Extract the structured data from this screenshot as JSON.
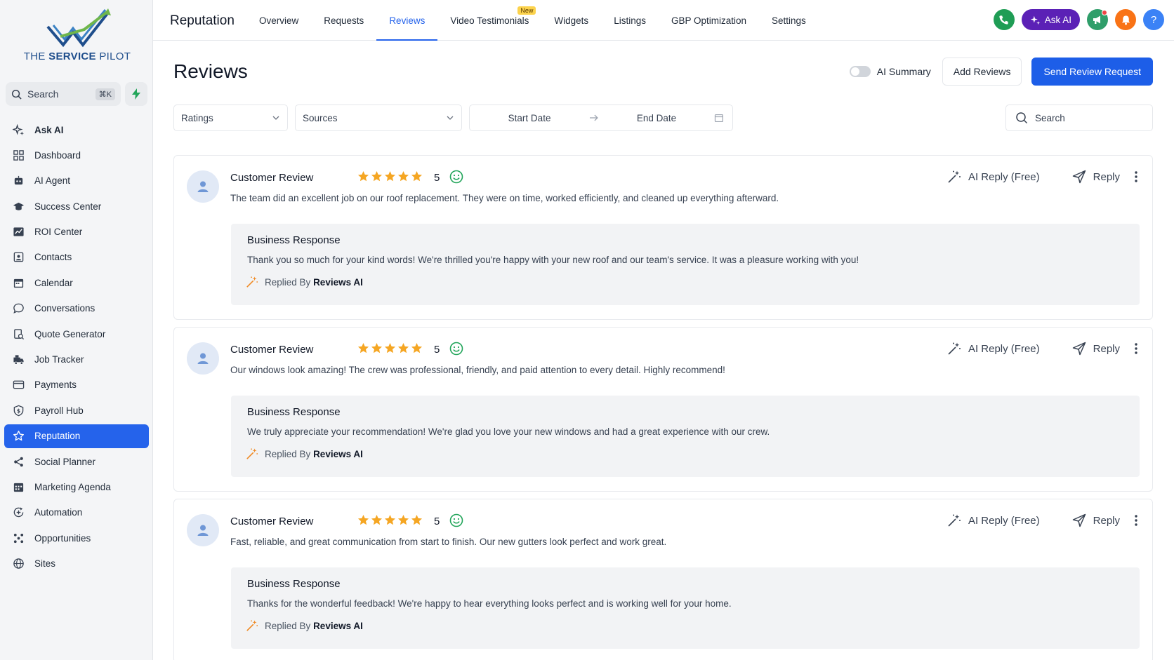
{
  "brand": {
    "name_part1": "THE",
    "name_part2": "SERVICE",
    "name_part3": "PILOT"
  },
  "sidebar": {
    "search_label": "Search",
    "search_shortcut": "⌘K",
    "items": [
      {
        "label": "Ask AI",
        "icon": "sparkle-icon"
      },
      {
        "label": "Dashboard",
        "icon": "grid-icon"
      },
      {
        "label": "AI Agent",
        "icon": "robot-icon"
      },
      {
        "label": "Success Center",
        "icon": "graduation-cap-icon"
      },
      {
        "label": "ROI Center",
        "icon": "chart-icon"
      },
      {
        "label": "Contacts",
        "icon": "contacts-icon"
      },
      {
        "label": "Calendar",
        "icon": "calendar-icon"
      },
      {
        "label": "Conversations",
        "icon": "chat-icon"
      },
      {
        "label": "Quote Generator",
        "icon": "quote-icon"
      },
      {
        "label": "Job Tracker",
        "icon": "truck-icon"
      },
      {
        "label": "Payments",
        "icon": "card-icon"
      },
      {
        "label": "Payroll Hub",
        "icon": "shield-icon"
      },
      {
        "label": "Reputation",
        "icon": "star-icon"
      },
      {
        "label": "Social Planner",
        "icon": "share-icon"
      },
      {
        "label": "Marketing Agenda",
        "icon": "calendar-grid-icon"
      },
      {
        "label": "Automation",
        "icon": "automation-icon"
      },
      {
        "label": "Opportunities",
        "icon": "opportunities-icon"
      },
      {
        "label": "Sites",
        "icon": "globe-icon"
      }
    ]
  },
  "topbar": {
    "title": "Reputation",
    "tabs": [
      {
        "label": "Overview"
      },
      {
        "label": "Requests"
      },
      {
        "label": "Reviews"
      },
      {
        "label": "Video Testimonials",
        "badge": "New"
      },
      {
        "label": "Widgets"
      },
      {
        "label": "Listings"
      },
      {
        "label": "GBP Optimization"
      },
      {
        "label": "Settings"
      }
    ],
    "ask_ai_label": "Ask AI",
    "help_label": "?"
  },
  "header": {
    "title": "Reviews",
    "ai_summary_label": "AI Summary",
    "add_reviews_label": "Add Reviews",
    "send_request_label": "Send Review Request"
  },
  "filters": {
    "ratings_label": "Ratings",
    "sources_label": "Sources",
    "start_date_label": "Start Date",
    "end_date_label": "End Date",
    "search_label": "Search"
  },
  "reviews": [
    {
      "author": "Customer Review",
      "rating": "5",
      "text": "The team did an excellent job on our roof replacement. They were on time, worked efficiently, and cleaned up everything afterward.",
      "ai_reply_label": "AI Reply (Free)",
      "reply_label": "Reply",
      "response_title": "Business Response",
      "response_text": "Thank you so much for your kind words! We're thrilled you're happy with your new roof and our team's service. It was a pleasure working with you!",
      "replied_by_prefix": "Replied By",
      "replied_by": "Reviews AI"
    },
    {
      "author": "Customer Review",
      "rating": "5",
      "text": "Our windows look amazing! The crew was professional, friendly, and paid attention to every detail. Highly recommend!",
      "ai_reply_label": "AI Reply (Free)",
      "reply_label": "Reply",
      "response_title": "Business Response",
      "response_text": "We truly appreciate your recommendation! We're glad you love your new windows and had a great experience with our crew.",
      "replied_by_prefix": "Replied By",
      "replied_by": "Reviews AI"
    },
    {
      "author": "Customer Review",
      "rating": "5",
      "text": "Fast, reliable, and great communication from start to finish. Our new gutters look perfect and work great.",
      "ai_reply_label": "AI Reply (Free)",
      "reply_label": "Reply",
      "response_title": "Business Response",
      "response_text": "Thanks for the wonderful feedback! We're happy to hear everything looks perfect and is working well for your home.",
      "replied_by_prefix": "Replied By",
      "replied_by": "Reviews AI"
    }
  ],
  "colors": {
    "accent": "#2563eb",
    "star": "#f5a623",
    "smiley": "#22a55a",
    "sidebar_bg": "#f4f5f7"
  }
}
